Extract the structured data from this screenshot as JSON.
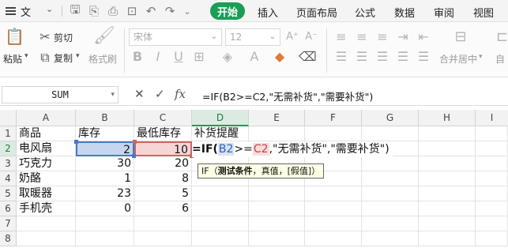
{
  "menubar": {
    "file_label": "文件",
    "tabs": [
      "开始",
      "插入",
      "页面布局",
      "公式",
      "数据",
      "审阅",
      "视图"
    ],
    "active_tab": "开始",
    "accent": "#1a9e56"
  },
  "ribbon": {
    "paste_label": "粘贴",
    "cut_label": "剪切",
    "copy_label": "复制",
    "format_painter_label": "格式刷",
    "font_name": "宋体",
    "font_size": "12",
    "merge_center_label": "合并居中",
    "auto_label": "自"
  },
  "formula_bar": {
    "name_box": "SUM",
    "formula": "=IF(B2>=C2,\"无需补货\",\"需要补货\")"
  },
  "grid": {
    "columns": [
      "A",
      "B",
      "C",
      "D",
      "E",
      "F",
      "G",
      "H",
      "I"
    ],
    "active_column": "D",
    "rows": [
      "1",
      "2",
      "3",
      "4",
      "5",
      "6",
      "7",
      "8"
    ],
    "active_row": "2",
    "header_row": [
      "商品",
      "库存",
      "最低库存",
      "补货提醒"
    ],
    "data": [
      {
        "a": "电风扇",
        "b": "2",
        "c": "10"
      },
      {
        "a": "巧克力",
        "b": "30",
        "c": "20"
      },
      {
        "a": "奶酪",
        "b": "1",
        "c": "8"
      },
      {
        "a": "取暖器",
        "b": "23",
        "c": "5"
      },
      {
        "a": "手机壳",
        "b": "0",
        "c": "6"
      }
    ],
    "edit": {
      "prefix": "=IF(",
      "ref_b": "B2",
      "op": ">=",
      "ref_c": "C2",
      "rest": ",\"无需补货\",\"需要补货\")"
    },
    "tooltip": {
      "fn": "IF",
      "open": "（",
      "arg_bold": "测试条件",
      "rest": "，真值，[假值]）"
    }
  }
}
